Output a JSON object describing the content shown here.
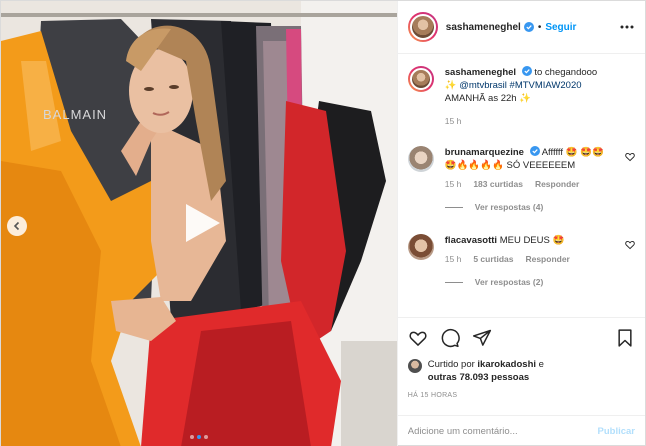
{
  "header": {
    "username": "sashameneghel",
    "separator": "•",
    "follow_label": "Seguir"
  },
  "caption": {
    "username": "sashameneghel",
    "text_1": "to chegandooo",
    "sparkle": "✨",
    "mention": "@mtvbrasil",
    "hashtag": "#MTVMIAW2020",
    "text_2": "AMANHÃ as 22h",
    "time": "15 h"
  },
  "comments": [
    {
      "username": "brunamarquezine",
      "text": "Affffff 🤩 🤩🤩🤩🔥🔥🔥🔥 SÓ VEEEEEEM",
      "time": "15 h",
      "likes": "183 curtidas",
      "reply_label": "Responder",
      "view_replies": "Ver respostas (4)"
    },
    {
      "username": "flacavasotti",
      "text": "MEU DEUS 🤩",
      "time": "15 h",
      "likes": "5 curtidas",
      "reply_label": "Responder",
      "view_replies": "Ver respostas (2)"
    }
  ],
  "likes": {
    "prefix": "Curtido por",
    "user": "ikarokadoshi",
    "conj": "e",
    "others": "outras 78.093 pessoas"
  },
  "timestamp": "HÁ 15 HORAS",
  "add_comment": {
    "placeholder": "Adicione um comentário...",
    "publish_label": "Publicar"
  },
  "carousel": {
    "dot_count": 3,
    "active_dot": 1
  },
  "colors": {
    "accent": "#0095f6",
    "verified": "#3897f0",
    "muted": "#8e8e8e"
  }
}
